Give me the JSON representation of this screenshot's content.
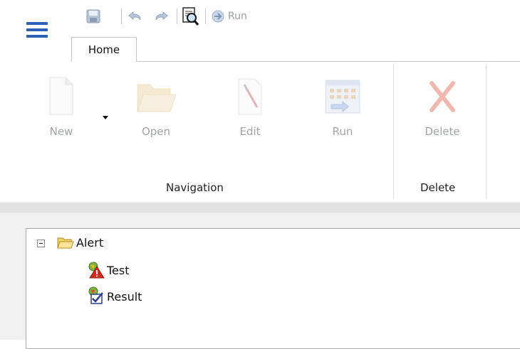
{
  "quick_access": {
    "items": [
      {
        "name": "save-icon"
      },
      {
        "name": "undo-icon"
      },
      {
        "name": "redo-icon"
      },
      {
        "name": "preview-icon"
      },
      {
        "name": "run-icon"
      }
    ],
    "run_label": "Run"
  },
  "tabs": [
    {
      "label": "Home",
      "active": true
    }
  ],
  "ribbon": {
    "groups": [
      {
        "label": "Navigation",
        "buttons": [
          {
            "label": "New",
            "icon": "new-document-icon",
            "enabled": false
          },
          {
            "label": "Open",
            "icon": "open-folder-icon",
            "enabled": false
          },
          {
            "label": "Edit",
            "icon": "edit-icon",
            "enabled": false
          },
          {
            "label": "Run",
            "icon": "run-grid-icon",
            "enabled": false
          }
        ]
      },
      {
        "label": "Delete",
        "buttons": [
          {
            "label": "Delete",
            "icon": "delete-x-icon",
            "enabled": false
          }
        ]
      }
    ]
  },
  "tree": {
    "root": {
      "label": "Alert",
      "expanded": true,
      "children": [
        {
          "label": "Test",
          "icon": "test-alert-icon"
        },
        {
          "label": "Result",
          "icon": "result-check-icon"
        }
      ]
    }
  },
  "colors": {
    "accent": "#2d5fb7",
    "disabled_text": "#a0a4a8",
    "ribbon_bottom": "#e2e2e2"
  }
}
